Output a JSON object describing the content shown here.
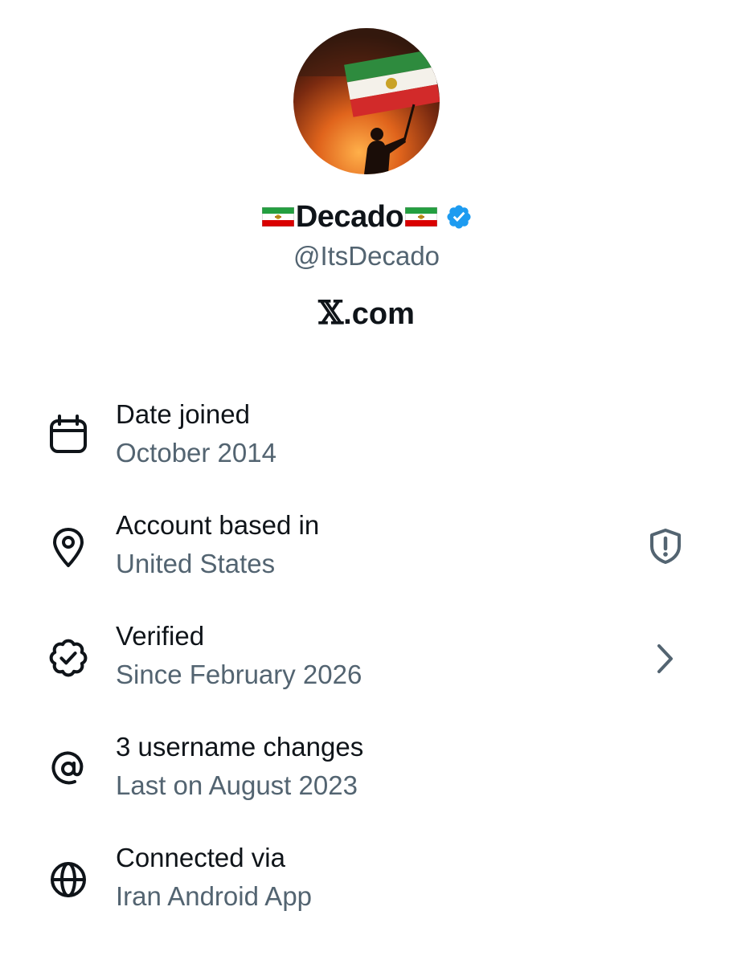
{
  "profile": {
    "display_name": "Decado",
    "handle": "@ItsDecado",
    "verified_badge_color": "#1d9bf0",
    "avatar_desc_icon": "avatar-image",
    "flag_icon": "iran-lion-and-sun-flag-icon"
  },
  "brand": {
    "mark": "𝕏",
    "domain": ".com"
  },
  "details": [
    {
      "icon": "calendar-icon",
      "title": "Date joined",
      "value": "October 2014",
      "trailing": null
    },
    {
      "icon": "location-pin-icon",
      "title": "Account based in",
      "value": "United States",
      "trailing": "shield-alert-icon"
    },
    {
      "icon": "verified-badge-icon",
      "title": "Verified",
      "value": "Since February 2026",
      "trailing": "chevron-right-icon"
    },
    {
      "icon": "at-sign-icon",
      "title": "3 username changes",
      "value": "Last on August 2023",
      "trailing": null
    },
    {
      "icon": "globe-icon",
      "title": "Connected via",
      "value": "Iran Android App",
      "trailing": null
    }
  ],
  "colors": {
    "primary_text": "#0f1419",
    "secondary_text": "#536471",
    "accent": "#1d9bf0"
  }
}
